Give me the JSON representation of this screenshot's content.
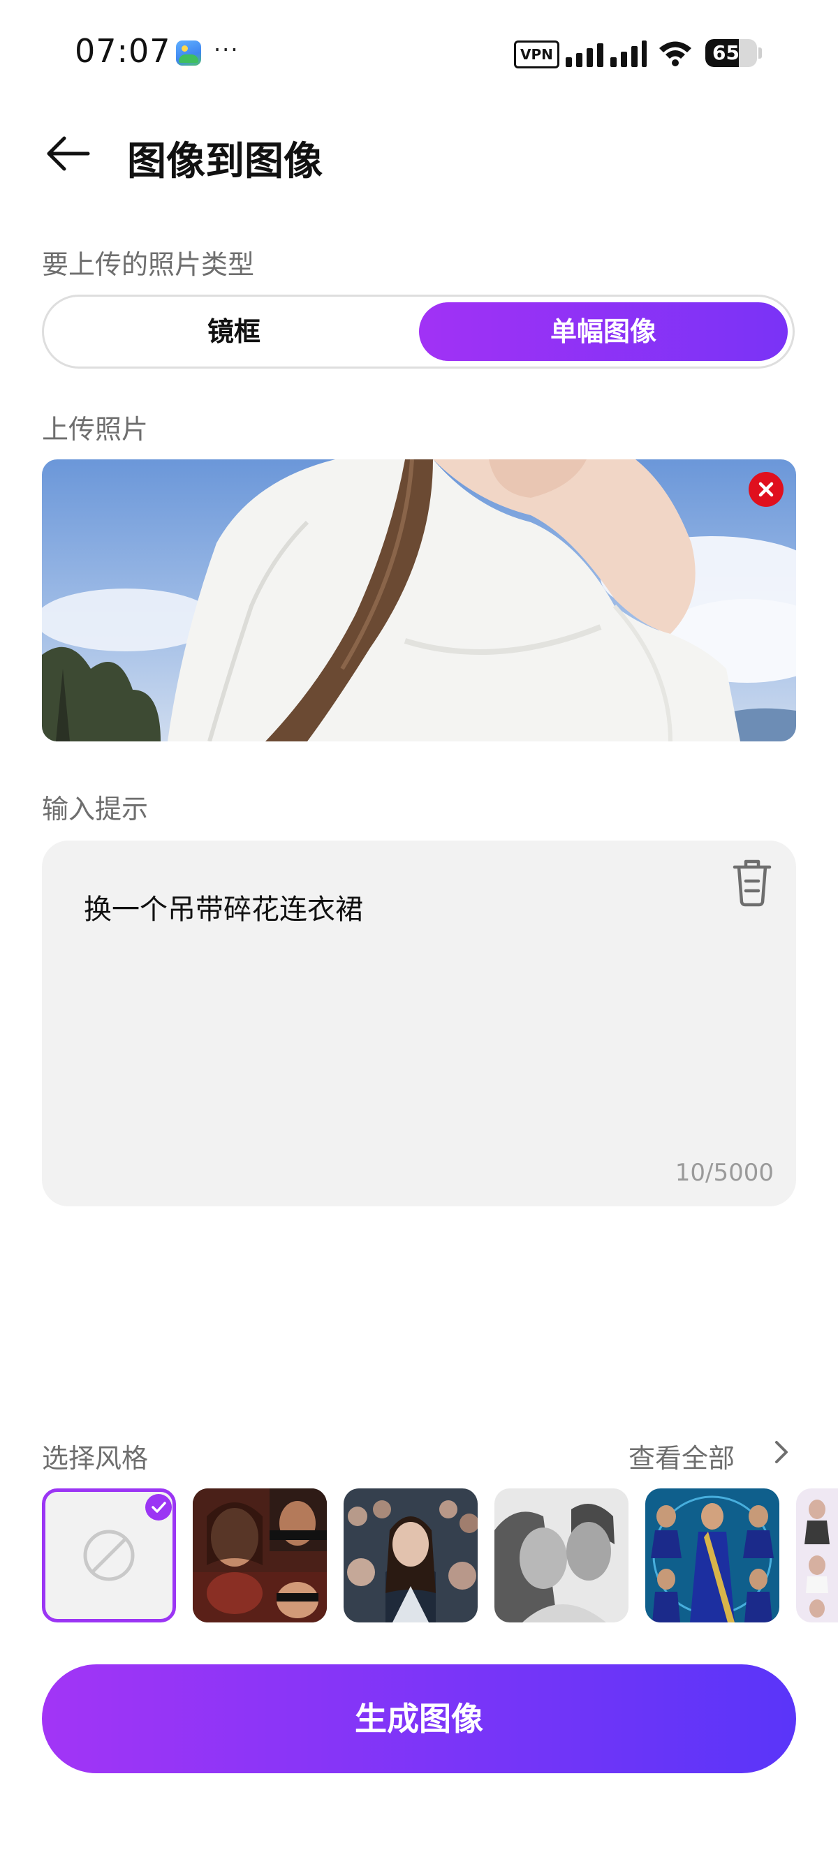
{
  "status_bar": {
    "time": "07:07",
    "notification_dots": "···",
    "vpn": "VPN",
    "battery": "65",
    "battery_fraction": 0.65,
    "icons": [
      "gallery-icon",
      "signal-icon",
      "wifi-icon",
      "battery-icon"
    ]
  },
  "header": {
    "back_icon": "arrow-left-icon",
    "title": "图像到图像"
  },
  "upload_type": {
    "label": "要上传的照片类型",
    "options": [
      "镜框",
      "单幅图像"
    ],
    "selected": "单幅图像"
  },
  "upload_photo": {
    "label": "上传照片",
    "remove_icon": "close-icon"
  },
  "prompt": {
    "label": "输入提示",
    "text": "换一个吊带碎花连衣裙",
    "counter": "10/5000",
    "clear_icon": "trash-icon"
  },
  "styles": {
    "label": "选择风格",
    "view_all": "查看全部",
    "selected_index": 0,
    "items": [
      "none",
      "collage-portrait",
      "crowd-portrait",
      "couple-bw",
      "blue-saree",
      "fashion-grid"
    ]
  },
  "generate_button": {
    "label": "生成图像"
  },
  "colors": {
    "accent_start": "#a235f6",
    "accent_end": "#5a35f9",
    "remove_red": "#e0101e"
  }
}
